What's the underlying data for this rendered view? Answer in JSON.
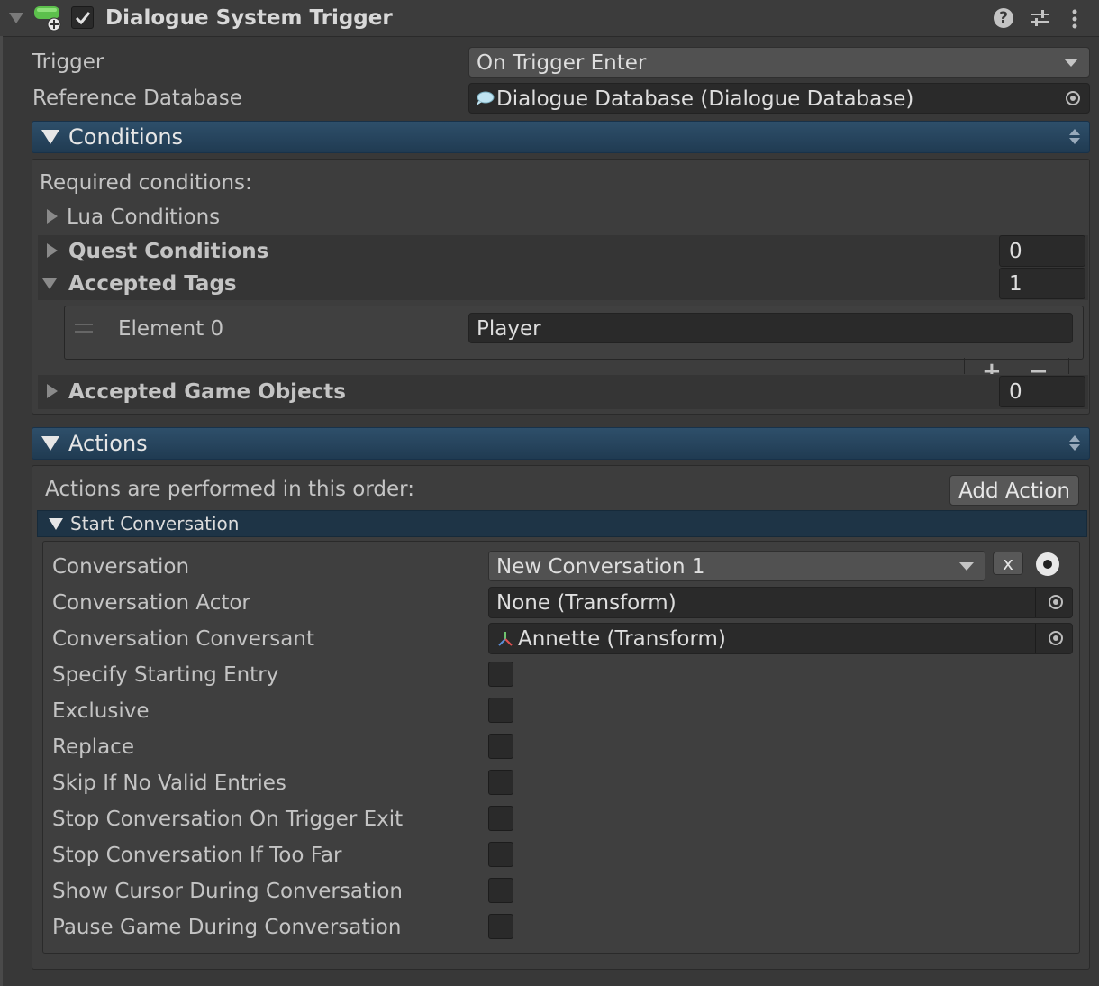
{
  "component": {
    "title": "Dialogue System Trigger",
    "enabled": true
  },
  "fields": {
    "trigger_label": "Trigger",
    "trigger_value": "On Trigger Enter",
    "database_label": "Reference Database",
    "database_value": "Dialogue Database (Dialogue Database)"
  },
  "conditions": {
    "title": "Conditions",
    "required_label": "Required conditions:",
    "lua_label": "Lua Conditions",
    "quest_label": "Quest Conditions",
    "quest_count": "0",
    "tags_label": "Accepted Tags",
    "tags_count": "1",
    "element0_label": "Element 0",
    "element0_value": "Player",
    "gameobjects_label": "Accepted Game Objects",
    "gameobjects_count": "0",
    "add_symbol": "+",
    "remove_symbol": "−"
  },
  "actions": {
    "title": "Actions",
    "order_label": "Actions are performed in this order:",
    "add_action_label": "Add Action",
    "start_conversation": {
      "title": "Start Conversation",
      "conversation_label": "Conversation",
      "conversation_value": "New Conversation 1",
      "clear_label": "x",
      "actor_label": "Conversation Actor",
      "actor_value": "None (Transform)",
      "conversant_label": "Conversation Conversant",
      "conversant_value": "Annette (Transform)",
      "toggles": [
        {
          "label": "Specify Starting Entry",
          "checked": false
        },
        {
          "label": "Exclusive",
          "checked": false
        },
        {
          "label": "Replace",
          "checked": false
        },
        {
          "label": "Skip If No Valid Entries",
          "checked": false
        },
        {
          "label": "Stop Conversation On Trigger Exit",
          "checked": false
        },
        {
          "label": "Stop Conversation If Too Far",
          "checked": false
        },
        {
          "label": "Show Cursor During Conversation",
          "checked": false
        },
        {
          "label": "Pause Game During Conversation",
          "checked": false
        }
      ]
    }
  },
  "colors": {
    "background": "#383838",
    "section_bar": "#203b52",
    "field_dark": "#2a2a2a",
    "text": "#c4c4c4",
    "icon_green": "#4caf50"
  }
}
